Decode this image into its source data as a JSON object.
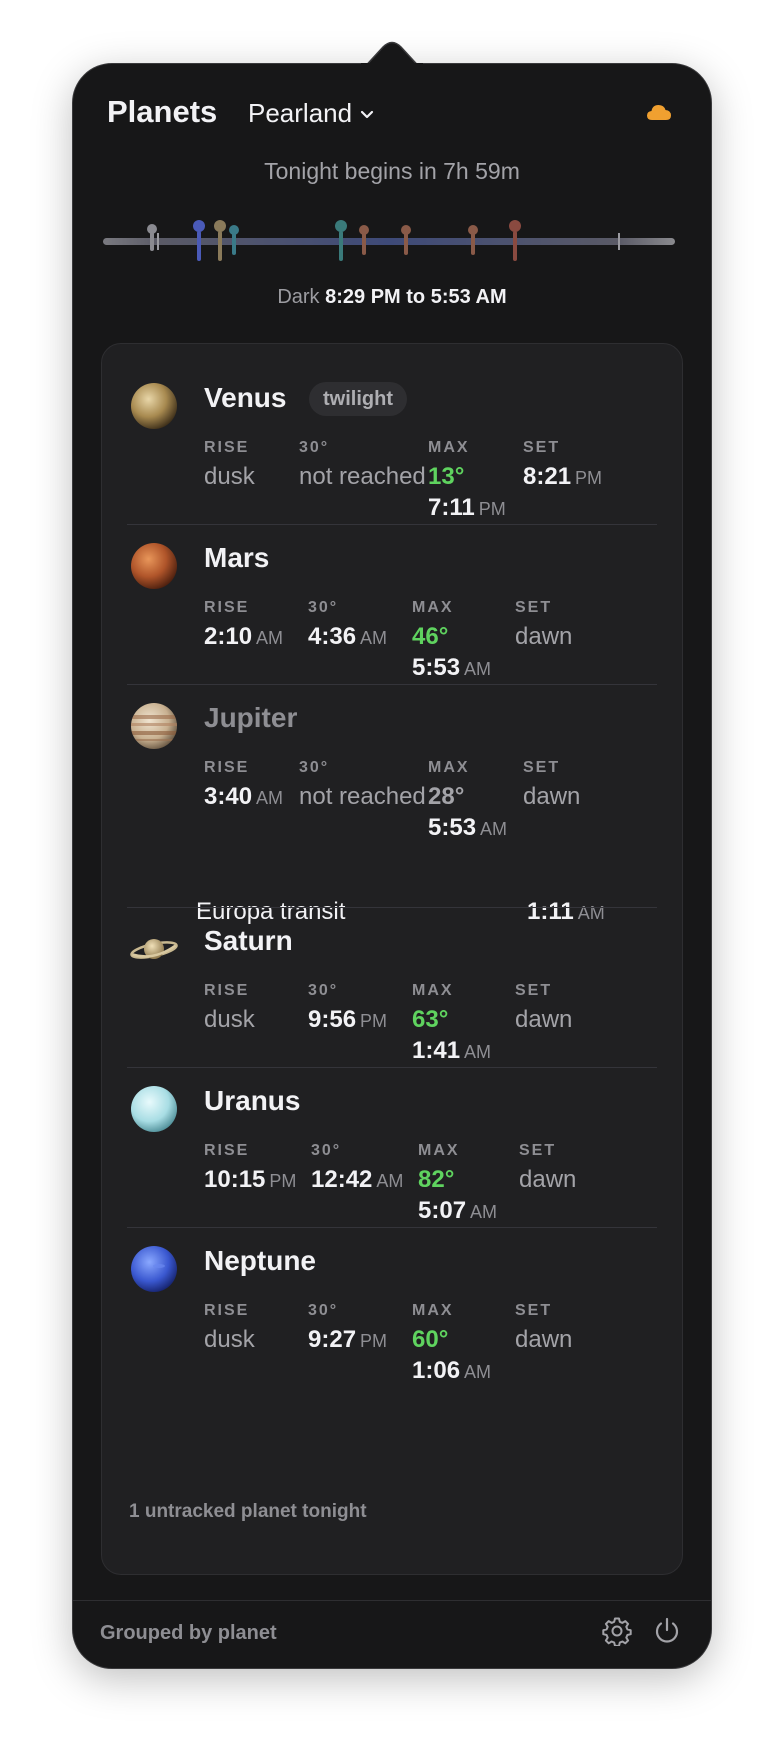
{
  "header": {
    "title": "Planets",
    "location": "Pearland",
    "weather_icon": "cloud-icon",
    "weather_color": "#f0a030"
  },
  "tonight_text": "Tonight begins in 7h 59m",
  "dark_window": {
    "label": "Dark",
    "range": "8:29 PM to 5:53 AM"
  },
  "colors": {
    "accent_green": "#5fd35f",
    "now_marker": "#3b7df0"
  },
  "planets": [
    {
      "name": "Venus",
      "badge": "twilight",
      "rise": {
        "label": "RISE",
        "value": "dusk"
      },
      "alt30": {
        "label": "30°",
        "value": "not reached"
      },
      "max": {
        "label": "MAX",
        "value": "13°",
        "time": "7:11",
        "ampm": "PM"
      },
      "set": {
        "label": "SET",
        "time": "8:21",
        "ampm": "PM"
      }
    },
    {
      "name": "Mars",
      "rise": {
        "label": "RISE",
        "time": "2:10",
        "ampm": "AM"
      },
      "alt30": {
        "label": "30°",
        "time": "4:36",
        "ampm": "AM"
      },
      "max": {
        "label": "MAX",
        "value": "46°",
        "time": "5:53",
        "ampm": "AM"
      },
      "set": {
        "label": "SET",
        "value": "dawn"
      }
    },
    {
      "name": "Jupiter",
      "rise": {
        "label": "RISE",
        "time": "3:40",
        "ampm": "AM"
      },
      "alt30": {
        "label": "30°",
        "value": "not reached"
      },
      "max": {
        "label": "MAX",
        "value": "28°",
        "time": "5:53",
        "ampm": "AM"
      },
      "set": {
        "label": "SET",
        "value": "dawn"
      },
      "event": {
        "name": "Europa transit",
        "time": "1:11",
        "ampm": "AM"
      }
    },
    {
      "name": "Saturn",
      "rise": {
        "label": "RISE",
        "value": "dusk"
      },
      "alt30": {
        "label": "30°",
        "time": "9:56",
        "ampm": "PM"
      },
      "max": {
        "label": "MAX",
        "value": "63°",
        "time": "1:41",
        "ampm": "AM"
      },
      "set": {
        "label": "SET",
        "value": "dawn"
      }
    },
    {
      "name": "Uranus",
      "rise": {
        "label": "RISE",
        "time": "10:15",
        "ampm": "PM"
      },
      "alt30": {
        "label": "30°",
        "time": "12:42",
        "ampm": "AM"
      },
      "max": {
        "label": "MAX",
        "value": "82°",
        "time": "5:07",
        "ampm": "AM"
      },
      "set": {
        "label": "SET",
        "value": "dawn"
      }
    },
    {
      "name": "Neptune",
      "rise": {
        "label": "RISE",
        "value": "dusk"
      },
      "alt30": {
        "label": "30°",
        "time": "9:27",
        "ampm": "PM"
      },
      "max": {
        "label": "MAX",
        "value": "60°",
        "time": "1:06",
        "ampm": "AM"
      },
      "set": {
        "label": "SET",
        "value": "dawn"
      }
    }
  ],
  "untracked_text": "1 untracked planet tonight",
  "footer": {
    "label": "Grouped by planet",
    "settings_icon": "gear-icon",
    "quit_icon": "power-icon"
  }
}
